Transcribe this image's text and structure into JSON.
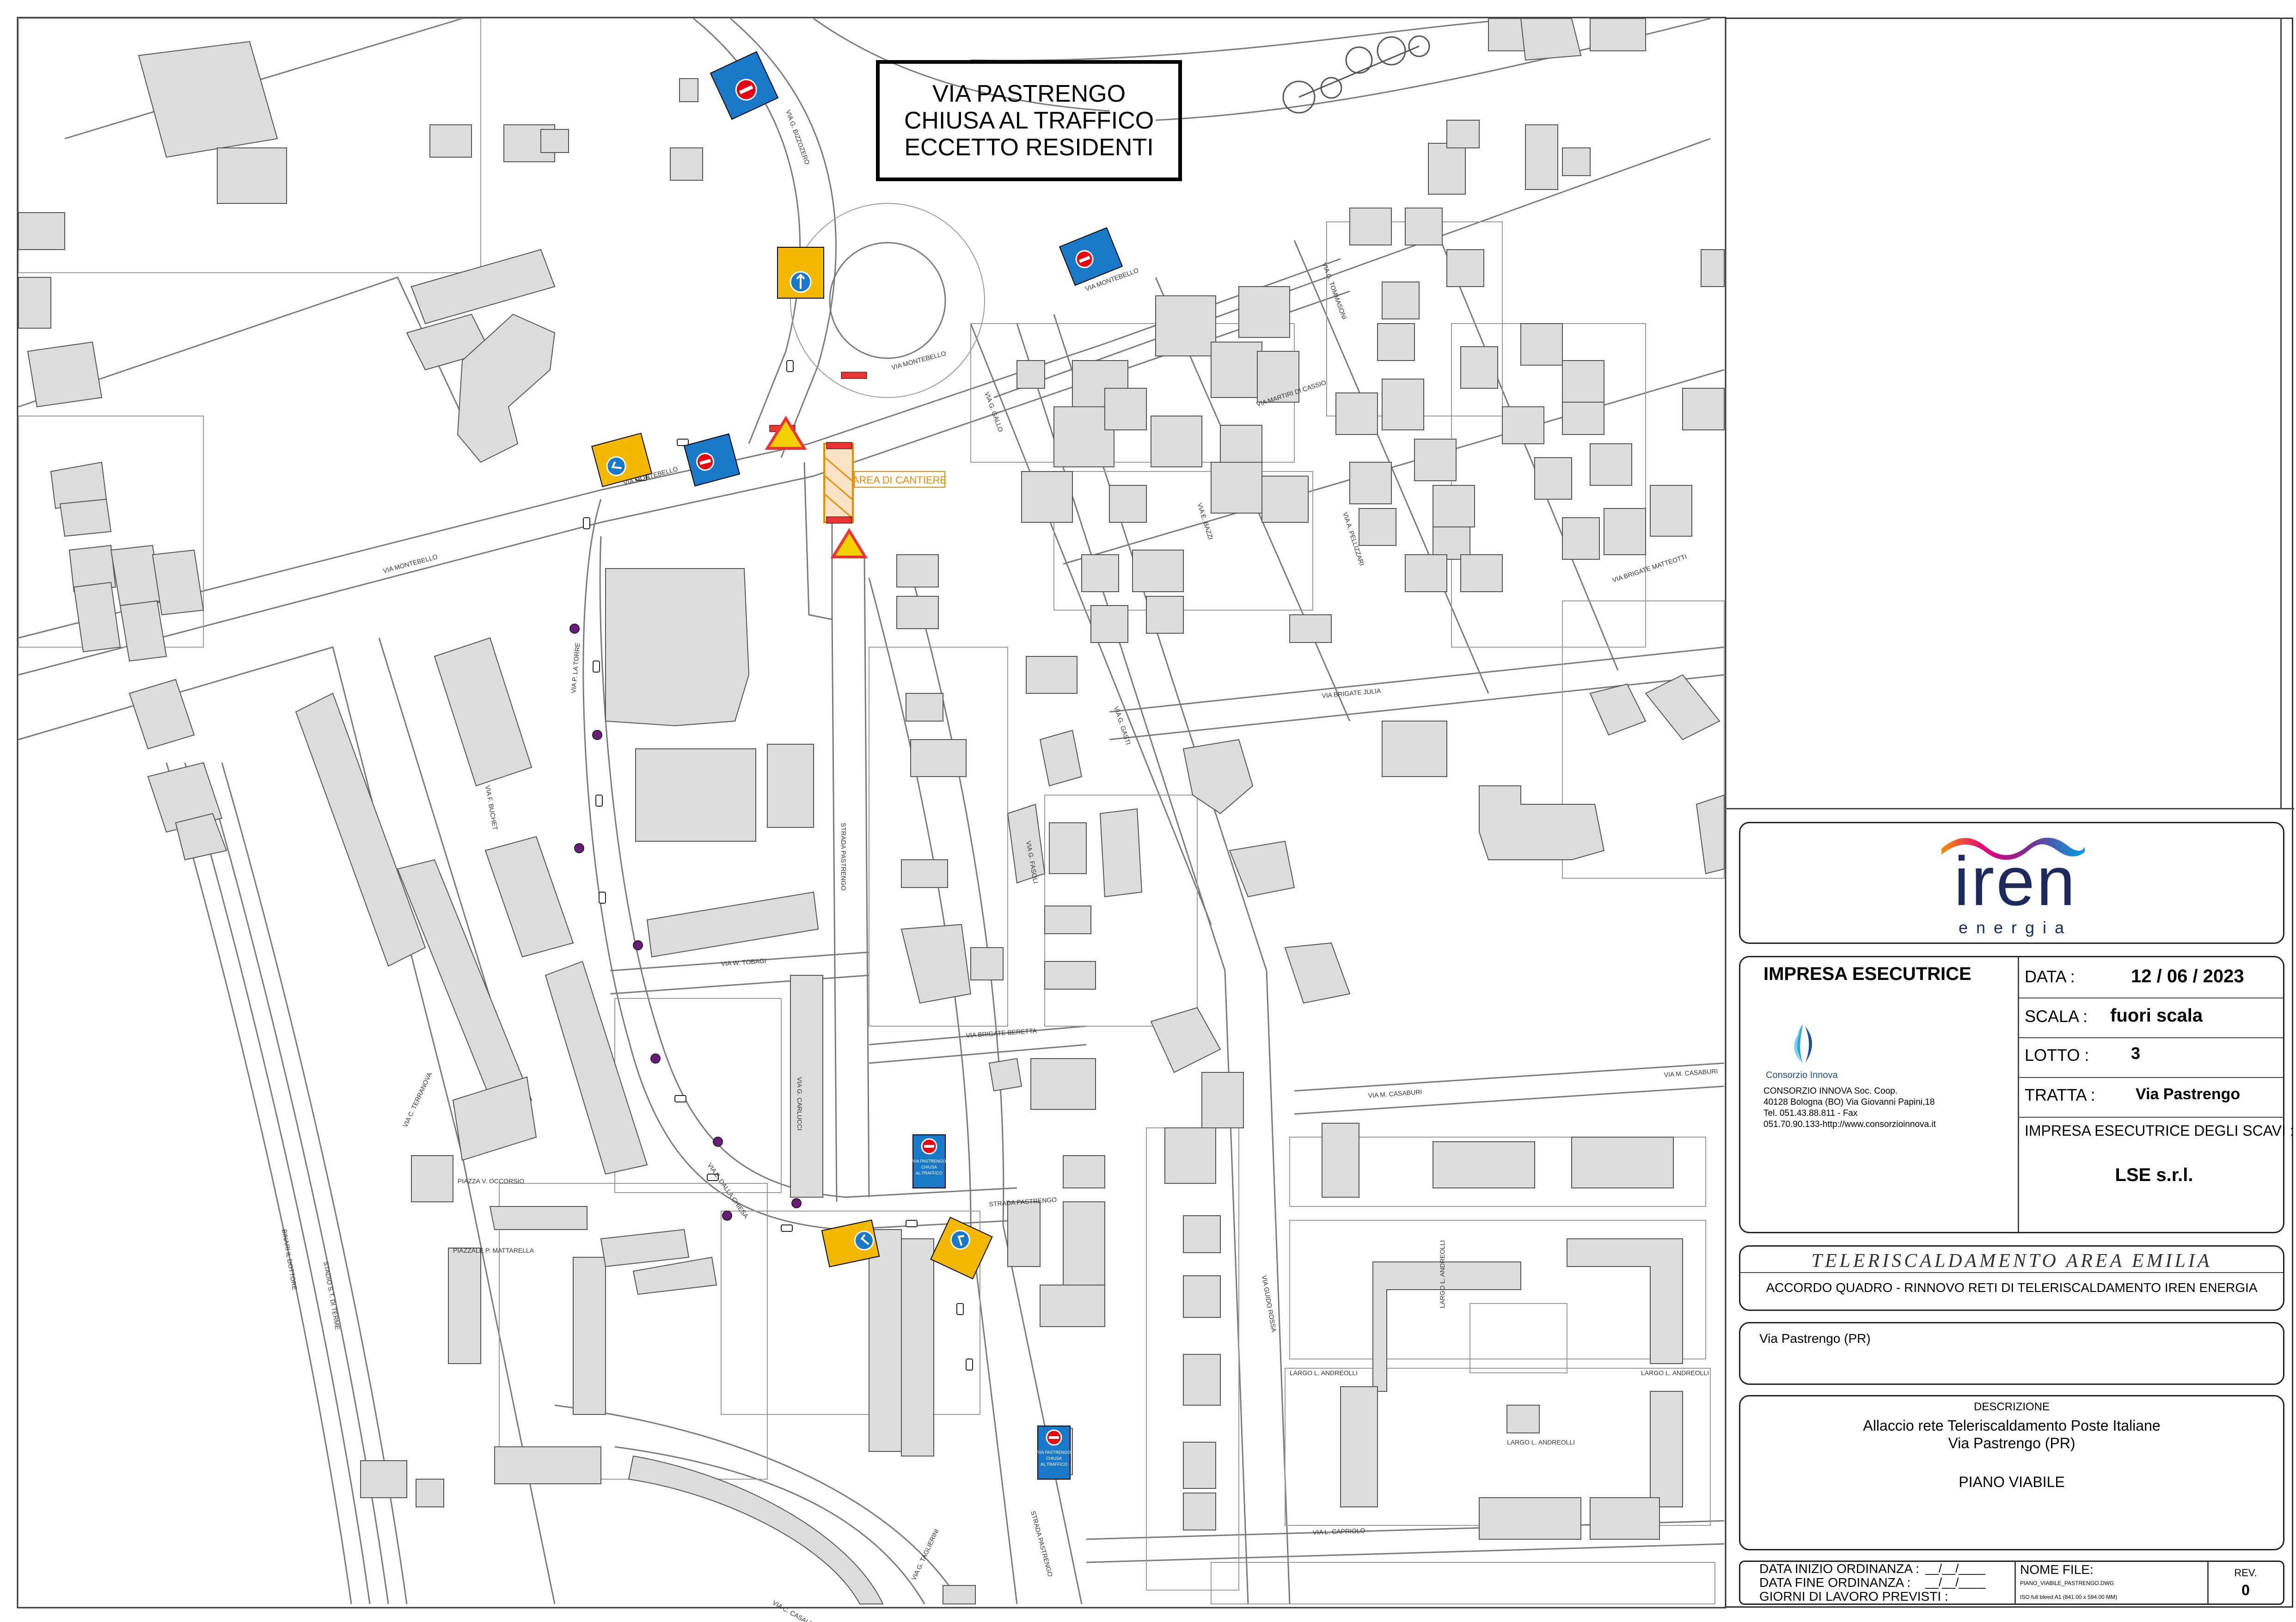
{
  "banner": {
    "line1": "VIA PASTRENGO",
    "line2": "CHIUSA AL TRAFFICO",
    "line3": "ECCETTO RESIDENTI"
  },
  "map": {
    "cantiere_label": "AREA DI CANTIERE",
    "streets": {
      "montebello_1": "VIA MONTEBELLO",
      "montebello_2": "VIA MONTEBELLO",
      "montebello_3": "VIA MONTEBELLO",
      "montebello_4": "VIA MONTEBELLO",
      "bizzozero": "VIA G. BIZZOZERO",
      "torelli": "VIA P. LA TORRE",
      "brigate_beretta": "VIA BRIGATE BERETTA",
      "tobagi": "VIA W. TOBAGI",
      "pastrengo_str": "STRADA PASTRENGO",
      "pastrengo_str2": "STRADA PASTRENGO",
      "pastrengo_str3": "STRADA PASTRENGO",
      "brigate_julia": "VIA BRIGATE JULIA",
      "casaburi_1": "VIA M. CASABURI",
      "casaburi_2": "VIA M. CASABURI",
      "brigate_matteotti": "VIA BRIGATE MATTEOTTI",
      "martiri_cassio": "VIA MARTIRI DI CASSIO",
      "carlucci": "VIA G. CARLUCCI",
      "fasoli": "VIA G. FASOLI",
      "taglierini": "VIA G. TAGLIERINI",
      "casalegno": "VIA C. CASALEGNO",
      "capriolo": "VIA L. CAPRIOLO",
      "andreolli_1": "LARGO L. ANDREOLLI",
      "andreolli_2": "LARGO L. ANDREOLLI",
      "andreolli_3": "LARGO L. ANDREOLLI",
      "andreolli_4": "LARGO L. ANDREOLLI",
      "occorsio": "PIAZZA V. OCCORSIO",
      "mattarella": "PIAZZALE P. MATTARELLA",
      "terranova": "VIA C. TERRANOVA",
      "buchet": "VIA F. BUCHET",
      "dalla_chiesa": "VIA E. DALLA CHIESA",
      "stadio": "STADIO S.T. DI TERME",
      "binari": "BINARI IL DOTTORE",
      "gasi": "VIA GUIDO ROSSA",
      "gallo": "VIA G. GALLO",
      "pellizzari": "VIA A. PELLIZZARI",
      "tommasoni": "VIA G. TOMMASONI",
      "bazzi": "VIA E. BAZZI",
      "gasti": "VIA G. GASTI"
    },
    "sign_texts": {
      "chiusa_1": "VIA PASTRENGO CHIUSA AL TRAFFICO ECCETTO RESIDENTI",
      "chiusa_2": "VIA PASTRENGO CHIUSA AL TRAFFICO ECCETTO RESIDENTI"
    }
  },
  "logo": {
    "brand": "iren",
    "tagline": "energia"
  },
  "impresa": {
    "heading": "IMPRESA ESECUTRICE",
    "company_logo_text": "Consorzio Innova",
    "address_1": "CONSORZIO INNOVA Soc. Coop.",
    "address_2": "40128 Bologna (BO) Via Giovanni Papini,18",
    "address_3": "Tel. 051.43.88.811 - Fax",
    "address_4": "051.70.90.133-http://www.consorzioinnova.it"
  },
  "meta": {
    "data_label": "DATA :",
    "data_value": "12 / 06 / 2023",
    "scala_label": "SCALA :",
    "scala_value": "fuori scala",
    "lotto_label": "LOTTO :",
    "lotto_value": "3",
    "tratta_label": "TRATTA :",
    "tratta_value": "Via Pastrengo",
    "scavi_label": "IMPRESA ESECUTRICE DEGLI SCAVI :",
    "scavi_value": "LSE s.r.l."
  },
  "project": {
    "title": "TELERISCALDAMENTO AREA EMILIA",
    "subtitle": "ACCORDO QUADRO - RINNOVO RETI DI TELERISCALDAMENTO IREN ENERGIA"
  },
  "location": "Via Pastrengo (PR)",
  "descrizione": {
    "label": "DESCRIZIONE",
    "line1": "Allaccio rete Teleriscaldamento Poste Italiane",
    "line2": "Via Pastrengo (PR)",
    "line3": "PIANO VIABILE"
  },
  "footer": {
    "inizio": "DATA INIZIO ORDINANZA :",
    "fine": "DATA FINE ORDINANZA :",
    "giorni": "GIORNI DI LAVORO PREVISTI :",
    "date_blank": "__/__/____",
    "nome_file_label": "NOME FILE:",
    "nome_file_value": "PIANO_VIABILE_PASTRENGO.DWG",
    "sheet": "ISO full bleed A1 (841.00 x 594.00 MM)",
    "rev_label": "REV.",
    "rev_value": "0"
  },
  "colors": {
    "building": "#dcdcdc",
    "blue_sign": "#1a78c8",
    "yellow_sign": "#f5b800",
    "cantiere": "#f08a00",
    "dot": "#6a1c7a"
  }
}
